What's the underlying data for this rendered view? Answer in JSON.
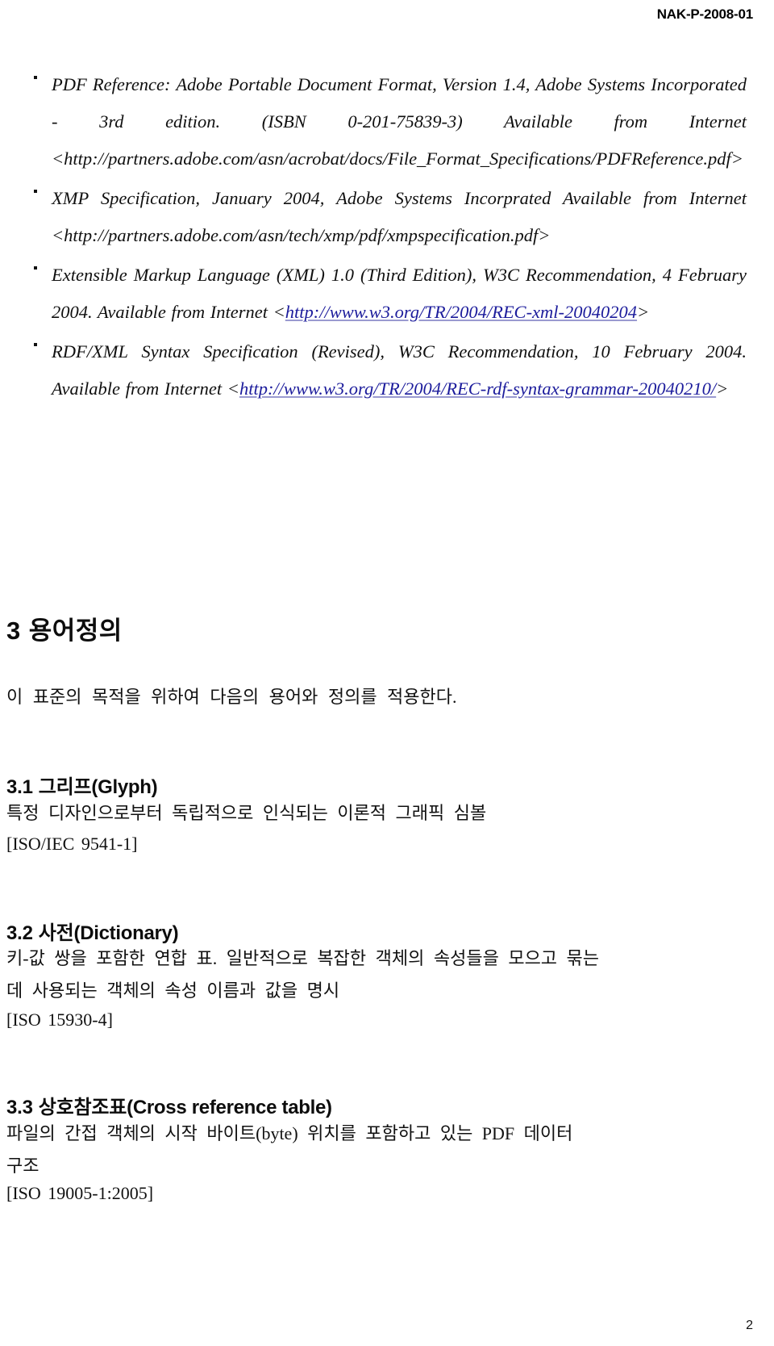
{
  "document": {
    "header_id": "NAK-P-2008-01",
    "page_number": "2"
  },
  "references": [
    {
      "name": "pdf-reference",
      "segments": [
        {
          "type": "text",
          "value": "PDF Reference: Adobe Portable Document Format, Version 1.4, Adobe Systems Incorporated - 3rd edition. (ISBN 0-201-75839-3) Available from Internet <http://partners.adobe.com/asn/acrobat/docs/File_Format_Specifications/PDFReference.pdf>"
        }
      ]
    },
    {
      "name": "xmp-specification",
      "segments": [
        {
          "type": "text",
          "value": "XMP Specification, January 2004, Adobe Systems Incorprated Available from Internet <http://partners.adobe.com/asn/tech/xmp/pdf/xmpspecification.pdf>"
        }
      ]
    },
    {
      "name": "xml-specification",
      "segments": [
        {
          "type": "text",
          "value": "Extensible Markup Language (XML) 1.0 (Third Edition), W3C Recommendation, 4 February 2004. Available from Internet <"
        },
        {
          "type": "link",
          "value": "http://www.w3.org/TR/2004/REC-xml-20040204"
        },
        {
          "type": "text",
          "value": ">"
        }
      ]
    },
    {
      "name": "rdf-xml-syntax",
      "segments": [
        {
          "type": "text",
          "value": "RDF/XML Syntax Specification (Revised), W3C Recommendation, 10 February 2004. Available from Internet <"
        },
        {
          "type": "link",
          "value": "http://www.w3.org/TR/2004/REC-rdf-syntax-grammar-20040210/"
        },
        {
          "type": "text",
          "value": ">"
        }
      ]
    }
  ],
  "section3": {
    "number": "3",
    "title": "용어정의",
    "intro": "이 표준의 목적을 위하여 다음의 용어와 정의를 적용한다."
  },
  "terms": [
    {
      "number": "3.1",
      "title_ko": "그리프",
      "title_en": "(Glyph)",
      "body_lines": [
        "특정 디자인으로부터 독립적으로 인식되는 이론적 그래픽 심볼"
      ],
      "source": "[ISO/IEC 9541-1]"
    },
    {
      "number": "3.2",
      "title_ko": "사전",
      "title_en": "(Dictionary)",
      "body_lines": [
        "키-값 쌍을 포함한 연합 표. 일반적으로 복잡한 객체의 속성들을 모으고 묶는",
        "데 사용되는 객체의 속성 이름과 값을 명시"
      ],
      "source": "[ISO 15930-4]"
    },
    {
      "number": "3.3",
      "title_ko": "상호참조표",
      "title_en": "(Cross reference table)",
      "body_lines": [
        "파일의 간접 객체의 시작 바이트(byte) 위치를 포함하고 있는 PDF 데이터",
        "구조"
      ],
      "source": "[ISO 19005-1:2005]"
    }
  ],
  "colors": {
    "text": "#111111",
    "link": "#1c1c9c",
    "link_underline": "#9a9ad0",
    "background": "#ffffff"
  }
}
